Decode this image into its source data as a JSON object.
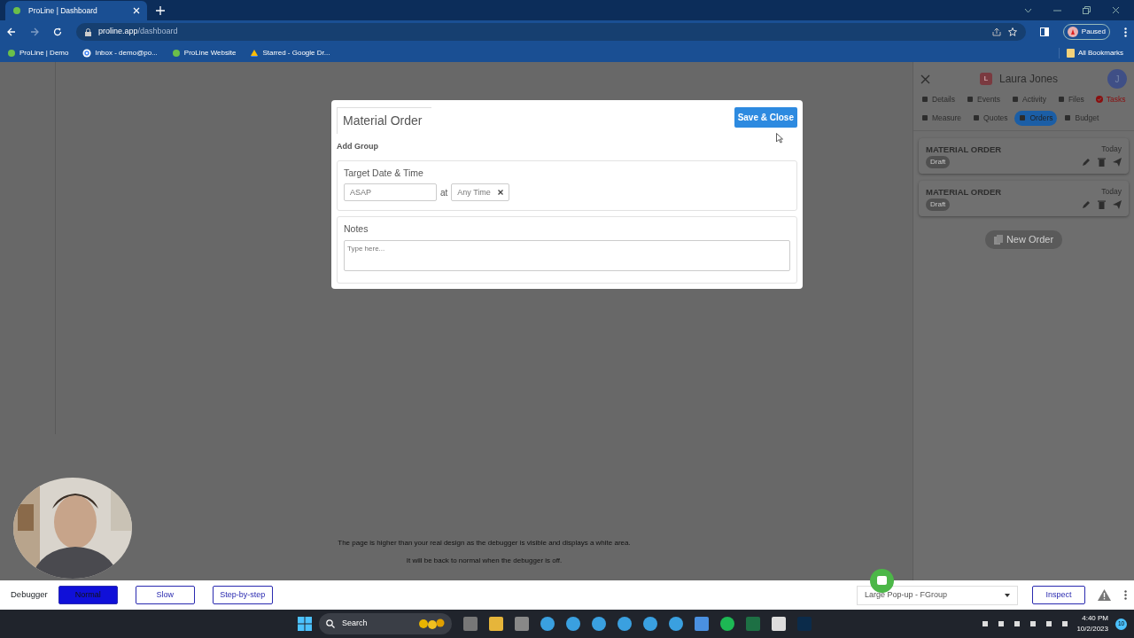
{
  "browser": {
    "tab_title": "ProLine | Dashboard",
    "url_host": "proline.app",
    "url_path": "/dashboard",
    "profile": "Paused",
    "bookmarks": [
      "ProLine | Demo",
      "Inbox - demo@po...",
      "ProLine Website",
      "Starred - Google Dr..."
    ],
    "all_bookmarks": "All Bookmarks"
  },
  "modal": {
    "title": "Material Order",
    "save_button": "Save & Close",
    "add_group": "Add Group",
    "target": {
      "label": "Target Date & Time",
      "date_placeholder": "ASAP",
      "at": "at",
      "time": "Any Time"
    },
    "notes": {
      "label": "Notes",
      "placeholder": "Type here..."
    }
  },
  "panel": {
    "contact_initial": "L",
    "contact_name": "Laura Jones",
    "user_initial": "J",
    "tabs": [
      {
        "label": "Details",
        "selected": false,
        "kind": "plain"
      },
      {
        "label": "Events",
        "selected": false,
        "kind": "plain"
      },
      {
        "label": "Activity",
        "selected": false,
        "kind": "plain"
      },
      {
        "label": "Files",
        "selected": false,
        "kind": "plain"
      },
      {
        "label": "Tasks",
        "selected": false,
        "kind": "alert"
      },
      {
        "label": "Measure",
        "selected": false,
        "kind": "plain"
      },
      {
        "label": "Quotes",
        "selected": false,
        "kind": "plain"
      },
      {
        "label": "Orders",
        "selected": true,
        "kind": "plain"
      },
      {
        "label": "Budget",
        "selected": false,
        "kind": "plain"
      }
    ],
    "orders": [
      {
        "title": "MATERIAL ORDER",
        "date": "Today",
        "status": "Draft"
      },
      {
        "title": "MATERIAL ORDER",
        "date": "Today",
        "status": "Draft"
      }
    ],
    "new_order": "New Order"
  },
  "notice": [
    "The page is higher than your real design as the debugger is visible and displays a white area.",
    "It will be back to normal when the debugger is off."
  ],
  "debugger": {
    "label": "Debugger",
    "speeds": [
      {
        "label": "Normal",
        "selected": true
      },
      {
        "label": "Slow",
        "selected": false
      },
      {
        "label": "Step-by-step",
        "selected": false
      }
    ],
    "view": "Large Pop-up - FGroup",
    "inspect": "Inspect"
  },
  "taskbar": {
    "search": "Search",
    "time": "4:40 PM",
    "date": "10/2/2023",
    "badge": "10"
  }
}
